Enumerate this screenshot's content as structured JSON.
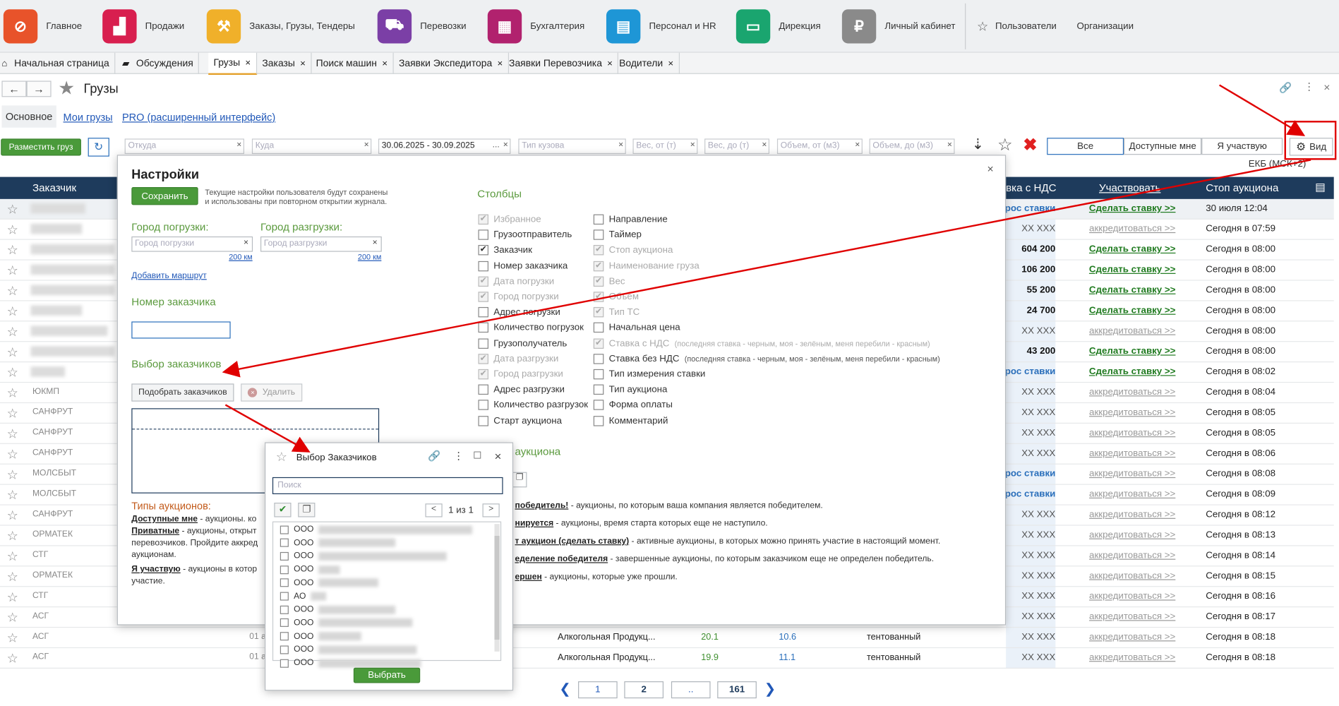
{
  "topnav": {
    "items": [
      {
        "label": "Главное",
        "icon": "logo-icon",
        "color": "#e8532a"
      },
      {
        "label": "Продажи",
        "icon": "sales-chart-icon",
        "color": "#d81f4f"
      },
      {
        "label": "Заказы,  Грузы, Тендеры",
        "icon": "gavel-icon",
        "color": "#f0b02a"
      },
      {
        "label": "Перевозки",
        "icon": "truck-icon",
        "color": "#7b3fa6"
      },
      {
        "label": "Бухгалтерия",
        "icon": "calculator-icon",
        "color": "#b1226e"
      },
      {
        "label": "Персонал и HR",
        "icon": "id-card-icon",
        "color": "#1e96d6"
      },
      {
        "label": "Дирекция",
        "icon": "briefcase-icon",
        "color": "#1aa56f"
      },
      {
        "label": "Личный кабинет",
        "icon": "lock-icon",
        "color": "#8a8a8a"
      }
    ],
    "right": {
      "users": "Пользователи",
      "orgs": "Организации"
    }
  },
  "tabs": [
    {
      "label": "Начальная страница",
      "closable": false
    },
    {
      "label": "Обсуждения",
      "closable": false
    },
    {
      "label": "Грузы",
      "closable": true
    },
    {
      "label": "Заказы",
      "closable": true
    },
    {
      "label": "Поиск машин",
      "closable": true
    },
    {
      "label": "Заявки Экспедитора",
      "closable": true
    },
    {
      "label": "Заявки Перевозчика",
      "closable": true
    },
    {
      "label": "Водители",
      "closable": true
    }
  ],
  "page": {
    "title": "Грузы",
    "subtabs": [
      "Основное",
      "Мои грузы",
      "PRO (расширенный интерфейс)"
    ],
    "post_button": "Разместить груз",
    "filters": {
      "from": "Откуда",
      "to": "Куда",
      "dates": "30.06.2025 - 30.09.2025",
      "body": "Тип кузова",
      "w_from": "Вес, от (т)",
      "w_to": "Вес, до (т)",
      "v_from": "Объем, от (м3)",
      "v_to": "Объем, до (м3)"
    },
    "segments": [
      "Все",
      "Доступные мне",
      "Я участвую"
    ],
    "view_button": "Вид",
    "timezone": "ЕКБ (МСК+2)"
  },
  "table": {
    "headers": {
      "customer": "Заказчик",
      "price": "вка с НДС",
      "participate": "Участвовать",
      "stop": "Стоп аукциона"
    },
    "rows": [
      {
        "customer": "",
        "price": "прос ставки",
        "participate": "Сделать ставку >>",
        "stop": "30 июля 12:04"
      },
      {
        "customer": "",
        "price": "XX XXX",
        "participate": "аккредитоваться >>",
        "stop": "Сегодня в 07:59"
      },
      {
        "customer": "",
        "price": "604 200",
        "participate": "Сделать ставку >>",
        "stop": "Сегодня в 08:00"
      },
      {
        "customer": "",
        "price": "106 200",
        "participate": "Сделать ставку >>",
        "stop": "Сегодня в 08:00"
      },
      {
        "customer": "",
        "price": "55 200",
        "participate": "Сделать ставку >>",
        "stop": "Сегодня в 08:00"
      },
      {
        "customer": "",
        "price": "24 700",
        "participate": "Сделать ставку >>",
        "stop": "Сегодня в 08:00"
      },
      {
        "customer": "",
        "price": "XX XXX",
        "participate": "аккредитоваться >>",
        "stop": "Сегодня в 08:00"
      },
      {
        "customer": "",
        "price": "43 200",
        "participate": "Сделать ставку >>",
        "stop": "Сегодня в 08:00"
      },
      {
        "customer": "",
        "price": "прос ставки",
        "participate": "Сделать ставку >>",
        "stop": "Сегодня в 08:02"
      },
      {
        "customer": "ЮКМП",
        "price": "XX XXX",
        "participate": "аккредитоваться >>",
        "stop": "Сегодня в 08:04"
      },
      {
        "customer": "САНФРУТ",
        "price": "XX XXX",
        "participate": "аккредитоваться >>",
        "stop": "Сегодня в 08:05"
      },
      {
        "customer": "САНФРУТ",
        "price": "XX XXX",
        "participate": "аккредитоваться >>",
        "stop": "Сегодня в 08:05"
      },
      {
        "customer": "САНФРУТ",
        "price": "XX XXX",
        "participate": "аккредитоваться >>",
        "stop": "Сегодня в 08:06"
      },
      {
        "customer": "МОЛСБЫТ",
        "price": "прос ставки",
        "participate": "аккредитоваться >>",
        "stop": "Сегодня в 08:08"
      },
      {
        "customer": "МОЛСБЫТ",
        "price": "прос ставки",
        "participate": "аккредитоваться >>",
        "stop": "Сегодня в 08:09"
      },
      {
        "customer": "САНФРУТ",
        "price": "XX XXX",
        "participate": "аккредитоваться >>",
        "stop": "Сегодня в 08:12"
      },
      {
        "customer": "ОРМАТЕК",
        "price": "XX XXX",
        "participate": "аккредитоваться >>",
        "stop": "Сегодня в 08:13"
      },
      {
        "customer": "СТГ",
        "price": "XX XXX",
        "participate": "аккредитоваться >>",
        "stop": "Сегодня в 08:14"
      },
      {
        "customer": "ОРМАТЕК",
        "price": "XX XXX",
        "participate": "аккредитоваться >>",
        "stop": "Сегодня в 08:15"
      },
      {
        "customer": "СТГ",
        "price": "XX XXX",
        "participate": "аккредитоваться >>",
        "stop": "Сегодня в 08:16"
      },
      {
        "customer": "АСГ",
        "price": "XX XXX",
        "participate": "аккредитоваться >>",
        "stop": "Сегодня в 08:17"
      },
      {
        "customer": "АСГ",
        "date": "01 а",
        "cargo": "Алкогольная Продукц...",
        "weight": "20.1",
        "volume": "10.6",
        "body": "тентованный",
        "price": "XX XXX",
        "participate": "аккредитоваться >>",
        "stop": "Сегодня в 08:18"
      },
      {
        "customer": "АСГ",
        "date": "01 а",
        "cargo": "Алкогольная Продукц...",
        "weight": "19.9",
        "volume": "11.1",
        "body": "тентованный",
        "price": "XX XXX",
        "participate": "аккредитоваться >>",
        "stop": "Сегодня в 08:18"
      }
    ]
  },
  "settings": {
    "title": "Настройки",
    "save": "Сохранить",
    "save_note_1": "Текущие настройки пользователя будут сохранены",
    "save_note_2": "и использованы при повторном открытии журнала.",
    "load_city": "Город погрузки:",
    "unload_city": "Город разгрузки:",
    "load_ph": "Город погрузки",
    "unload_ph": "Город разгрузки",
    "radius": "200 км",
    "add_route": "Добавить маршрут",
    "customer_no": "Номер заказчика",
    "customer_select": "Выбор заказчиков",
    "pick_btn": "Подобрать заказчиков",
    "delete_btn": "Удалить",
    "columns_title": "Столбцы",
    "col_left": [
      {
        "label": "Избранное",
        "checked": true,
        "disabled": true
      },
      {
        "label": "Грузоотправитель",
        "checked": false,
        "disabled": false
      },
      {
        "label": "Заказчик",
        "checked": true,
        "disabled": false
      },
      {
        "label": "Номер заказчика",
        "checked": false,
        "disabled": false
      },
      {
        "label": "Дата погрузки",
        "checked": true,
        "disabled": true
      },
      {
        "label": "Город погрузки",
        "checked": true,
        "disabled": true
      },
      {
        "label": "Адрес погрузки",
        "checked": false,
        "disabled": false
      },
      {
        "label": "Количество погрузок",
        "checked": false,
        "disabled": false
      },
      {
        "label": "Грузополучатель",
        "checked": false,
        "disabled": false
      },
      {
        "label": "Дата разгрузки",
        "checked": true,
        "disabled": true
      },
      {
        "label": "Город разгрузки",
        "checked": true,
        "disabled": true
      },
      {
        "label": "Адрес разгрузки",
        "checked": false,
        "disabled": false
      },
      {
        "label": "Количество разгрузок",
        "checked": false,
        "disabled": false
      },
      {
        "label": "Старт аукциона",
        "checked": false,
        "disabled": false
      }
    ],
    "col_right": [
      {
        "label": "Направление",
        "checked": false,
        "disabled": false,
        "note": ""
      },
      {
        "label": "Таймер",
        "checked": false,
        "disabled": false,
        "note": ""
      },
      {
        "label": "Стоп аукциона",
        "checked": true,
        "disabled": true,
        "note": ""
      },
      {
        "label": "Наименование груза",
        "checked": true,
        "disabled": true,
        "note": ""
      },
      {
        "label": "Вес",
        "checked": true,
        "disabled": true,
        "note": ""
      },
      {
        "label": "Объем",
        "checked": true,
        "disabled": true,
        "note": ""
      },
      {
        "label": "Тип ТС",
        "checked": true,
        "disabled": true,
        "note": ""
      },
      {
        "label": "Начальная цена",
        "checked": false,
        "disabled": false,
        "note": ""
      },
      {
        "label": "Ставка с НДС",
        "checked": true,
        "disabled": true,
        "note": "(последняя ставка - черным,  моя - зелёным, меня перебили - красным)"
      },
      {
        "label": "Ставка без НДС",
        "checked": false,
        "disabled": false,
        "note": "(последняя ставка - черным,  моя - зелёным, меня перебили - красным)"
      },
      {
        "label": "Тип измерения ставки",
        "checked": false,
        "disabled": false,
        "note": ""
      },
      {
        "label": "Тип аукциона",
        "checked": false,
        "disabled": false,
        "note": ""
      },
      {
        "label": "Форма оплаты",
        "checked": false,
        "disabled": false,
        "note": ""
      },
      {
        "label": "Комментарий",
        "checked": false,
        "disabled": false,
        "note": ""
      }
    ],
    "auction_types_title": "Типы аукционов:",
    "left_desc": [
      {
        "term": "Доступные мне",
        "text": " - аукционы. ко"
      },
      {
        "term": "Приватные",
        "text": " - аукционы, открыт"
      },
      {
        "term": "",
        "text": "перевозчиков. Пройдите аккред"
      },
      {
        "term": "",
        "text": "аукционам."
      },
      {
        "term": "Я участвую",
        "text": " - аукционы в котор"
      },
      {
        "term": "",
        "text": "участие."
      }
    ],
    "right_section_title": "аукциона",
    "right_desc": [
      {
        "term": "победитель!",
        "text": " - аукционы, по которым ваша компания является победителем."
      },
      {
        "term": "нируется",
        "text": " - аукционы, время старта которых еще не наступило."
      },
      {
        "term": "т аукцион (сделать ставку)",
        "text": " - активные аукционы, в которых можно принять участие в настоящий момент."
      },
      {
        "term": "еделение победителя",
        "text": " - завершенные аукционы, по которым заказчиком еще не определен победитель."
      },
      {
        "term": "ершен",
        "text": " - аукционы, которые уже прошли."
      }
    ]
  },
  "picker": {
    "title": "Выбор Заказчиков",
    "search_ph": "Поиск",
    "pager": "1 из 1",
    "items": [
      "ООО",
      "ООО",
      "ООО",
      "ООО",
      "ООО",
      "АО",
      "ООО",
      "ООО",
      "ООО",
      "ООО",
      "ООО"
    ],
    "select_btn": "Выбрать"
  },
  "pagination": {
    "pages": [
      "1",
      "2",
      "..",
      "161"
    ],
    "current": "2"
  },
  "colors": {
    "accent_green": "#4a9a3a",
    "header_navy": "#1e3b5c",
    "annotation_red": "#e00000",
    "link_blue": "#2158b8"
  }
}
